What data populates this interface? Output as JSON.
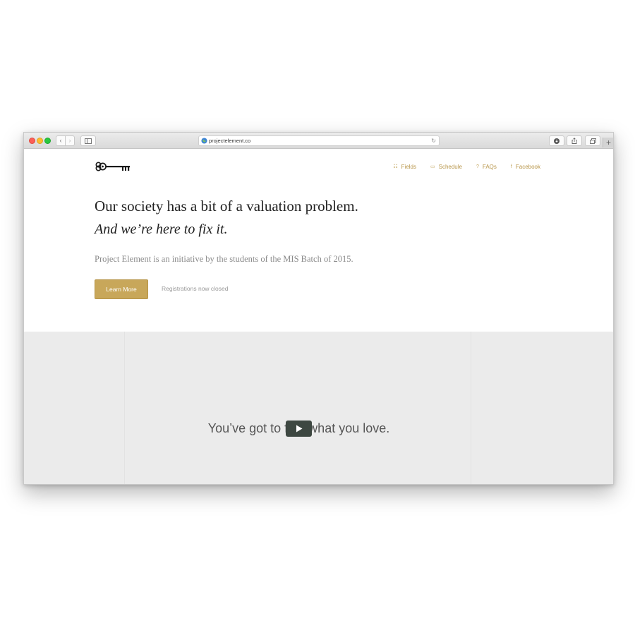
{
  "browser": {
    "url": "projectelement.co",
    "nav_back_glyph": "‹",
    "nav_forward_glyph": "›",
    "reload_glyph": "↻",
    "new_tab_glyph": "+",
    "icons": [
      "back-icon",
      "forward-icon",
      "sidebar-icon",
      "globe-icon",
      "reload-icon",
      "download-icon",
      "share-icon",
      "tabs-icon",
      "plus-icon"
    ]
  },
  "site": {
    "logo": "key-icon",
    "nav": [
      {
        "label": "Fields",
        "icon": "grid-icon",
        "glyph": "☷"
      },
      {
        "label": "Schedule",
        "icon": "calendar-icon",
        "glyph": "▭"
      },
      {
        "label": "FAQs",
        "icon": "question-icon",
        "glyph": "?"
      },
      {
        "label": "Facebook",
        "icon": "facebook-icon",
        "glyph": "f"
      }
    ],
    "accent_color": "#c8a75a"
  },
  "hero": {
    "headline": "Our society has a bit of a valuation problem.",
    "subheadline": "And we’re here to fix it.",
    "intro": "Project Element is an initiative by the students of the MIS Batch of 2015.",
    "cta_label": "Learn More",
    "status": "Registrations now closed"
  },
  "video": {
    "caption": "You’ve got to find what you love.",
    "play_icon": "play-icon"
  }
}
